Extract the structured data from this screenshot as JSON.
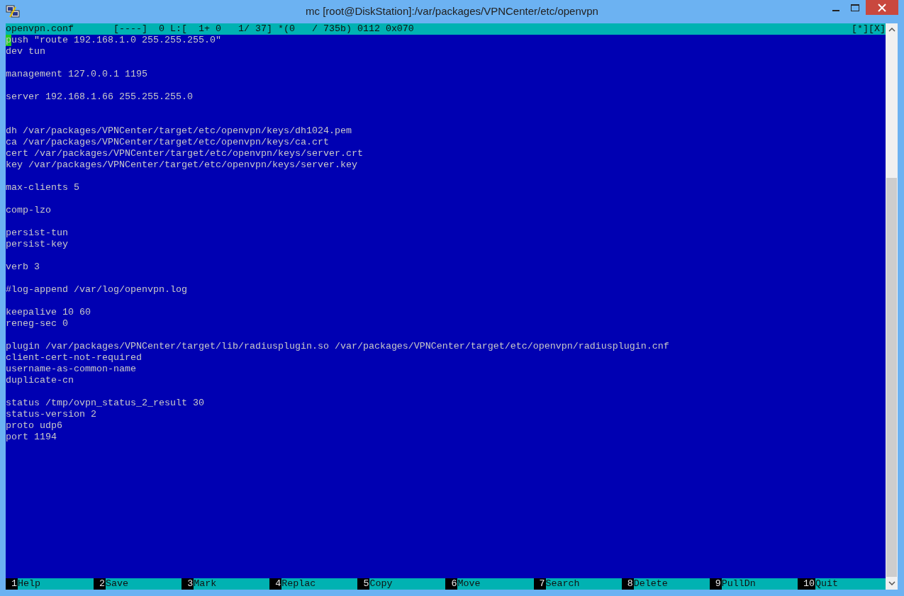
{
  "window": {
    "title": "mc [root@DiskStation]:/var/packages/VPNCenter/etc/openvpn"
  },
  "status_line": {
    "info": "openvpn.conf       [----]  0 L:[  1+ 0   1/ 37] *(0   / 735b) 0112 0x070",
    "buttons": [
      "[*]",
      "[X]"
    ]
  },
  "lines": [
    {
      "kind": "text",
      "text": "push \"route 192.168.1.0 255.255.255.0\"",
      "cursor": true
    },
    {
      "kind": "text",
      "text": "dev tun",
      "cursor": false
    },
    {
      "kind": "blank"
    },
    {
      "kind": "text",
      "text": "management 127.0.0.1 1195",
      "cursor": false
    },
    {
      "kind": "blank"
    },
    {
      "kind": "text",
      "text": "server 192.168.1.66 255.255.255.0",
      "cursor": false
    },
    {
      "kind": "blank"
    },
    {
      "kind": "blank"
    },
    {
      "kind": "text",
      "text": "dh /var/packages/VPNCenter/target/etc/openvpn/keys/dh1024.pem",
      "cursor": false
    },
    {
      "kind": "text",
      "text": "ca /var/packages/VPNCenter/target/etc/openvpn/keys/ca.crt",
      "cursor": false
    },
    {
      "kind": "text",
      "text": "cert /var/packages/VPNCenter/target/etc/openvpn/keys/server.crt",
      "cursor": false
    },
    {
      "kind": "text",
      "text": "key /var/packages/VPNCenter/target/etc/openvpn/keys/server.key",
      "cursor": false
    },
    {
      "kind": "blank"
    },
    {
      "kind": "text",
      "text": "max-clients 5",
      "cursor": false
    },
    {
      "kind": "blank"
    },
    {
      "kind": "text",
      "text": "comp-lzo",
      "cursor": false
    },
    {
      "kind": "blank"
    },
    {
      "kind": "text",
      "text": "persist-tun",
      "cursor": false
    },
    {
      "kind": "text",
      "text": "persist-key",
      "cursor": false
    },
    {
      "kind": "blank"
    },
    {
      "kind": "text",
      "text": "verb 3",
      "cursor": false
    },
    {
      "kind": "blank"
    },
    {
      "kind": "text",
      "text": "#log-append /var/log/openvpn.log",
      "cursor": false
    },
    {
      "kind": "blank"
    },
    {
      "kind": "text",
      "text": "keepalive 10 60",
      "cursor": false
    },
    {
      "kind": "text",
      "text": "reneg-sec 0",
      "cursor": false
    },
    {
      "kind": "blank"
    },
    {
      "kind": "text",
      "text": "plugin /var/packages/VPNCenter/target/lib/radiusplugin.so /var/packages/VPNCenter/target/etc/openvpn/radiusplugin.cnf",
      "cursor": false
    },
    {
      "kind": "text",
      "text": "client-cert-not-required",
      "cursor": false
    },
    {
      "kind": "text",
      "text": "username-as-common-name",
      "cursor": false
    },
    {
      "kind": "text",
      "text": "duplicate-cn",
      "cursor": false
    },
    {
      "kind": "blank"
    },
    {
      "kind": "text",
      "text": "status /tmp/ovpn_status_2_result 30",
      "cursor": false
    },
    {
      "kind": "text",
      "text": "status-version 2",
      "cursor": false
    },
    {
      "kind": "text",
      "text": "proto udp6",
      "cursor": false
    },
    {
      "kind": "text",
      "text": "port 1194",
      "cursor": false
    }
  ],
  "function_keys": [
    {
      "key": "1",
      "label": "Help"
    },
    {
      "key": "2",
      "label": "Save"
    },
    {
      "key": "3",
      "label": "Mark"
    },
    {
      "key": "4",
      "label": "Replac"
    },
    {
      "key": "5",
      "label": "Copy"
    },
    {
      "key": "6",
      "label": "Move"
    },
    {
      "key": "7",
      "label": "Search"
    },
    {
      "key": "8",
      "label": "Delete"
    },
    {
      "key": "9",
      "label": "PullDn"
    },
    {
      "key": "10",
      "label": "Quit"
    }
  ]
}
